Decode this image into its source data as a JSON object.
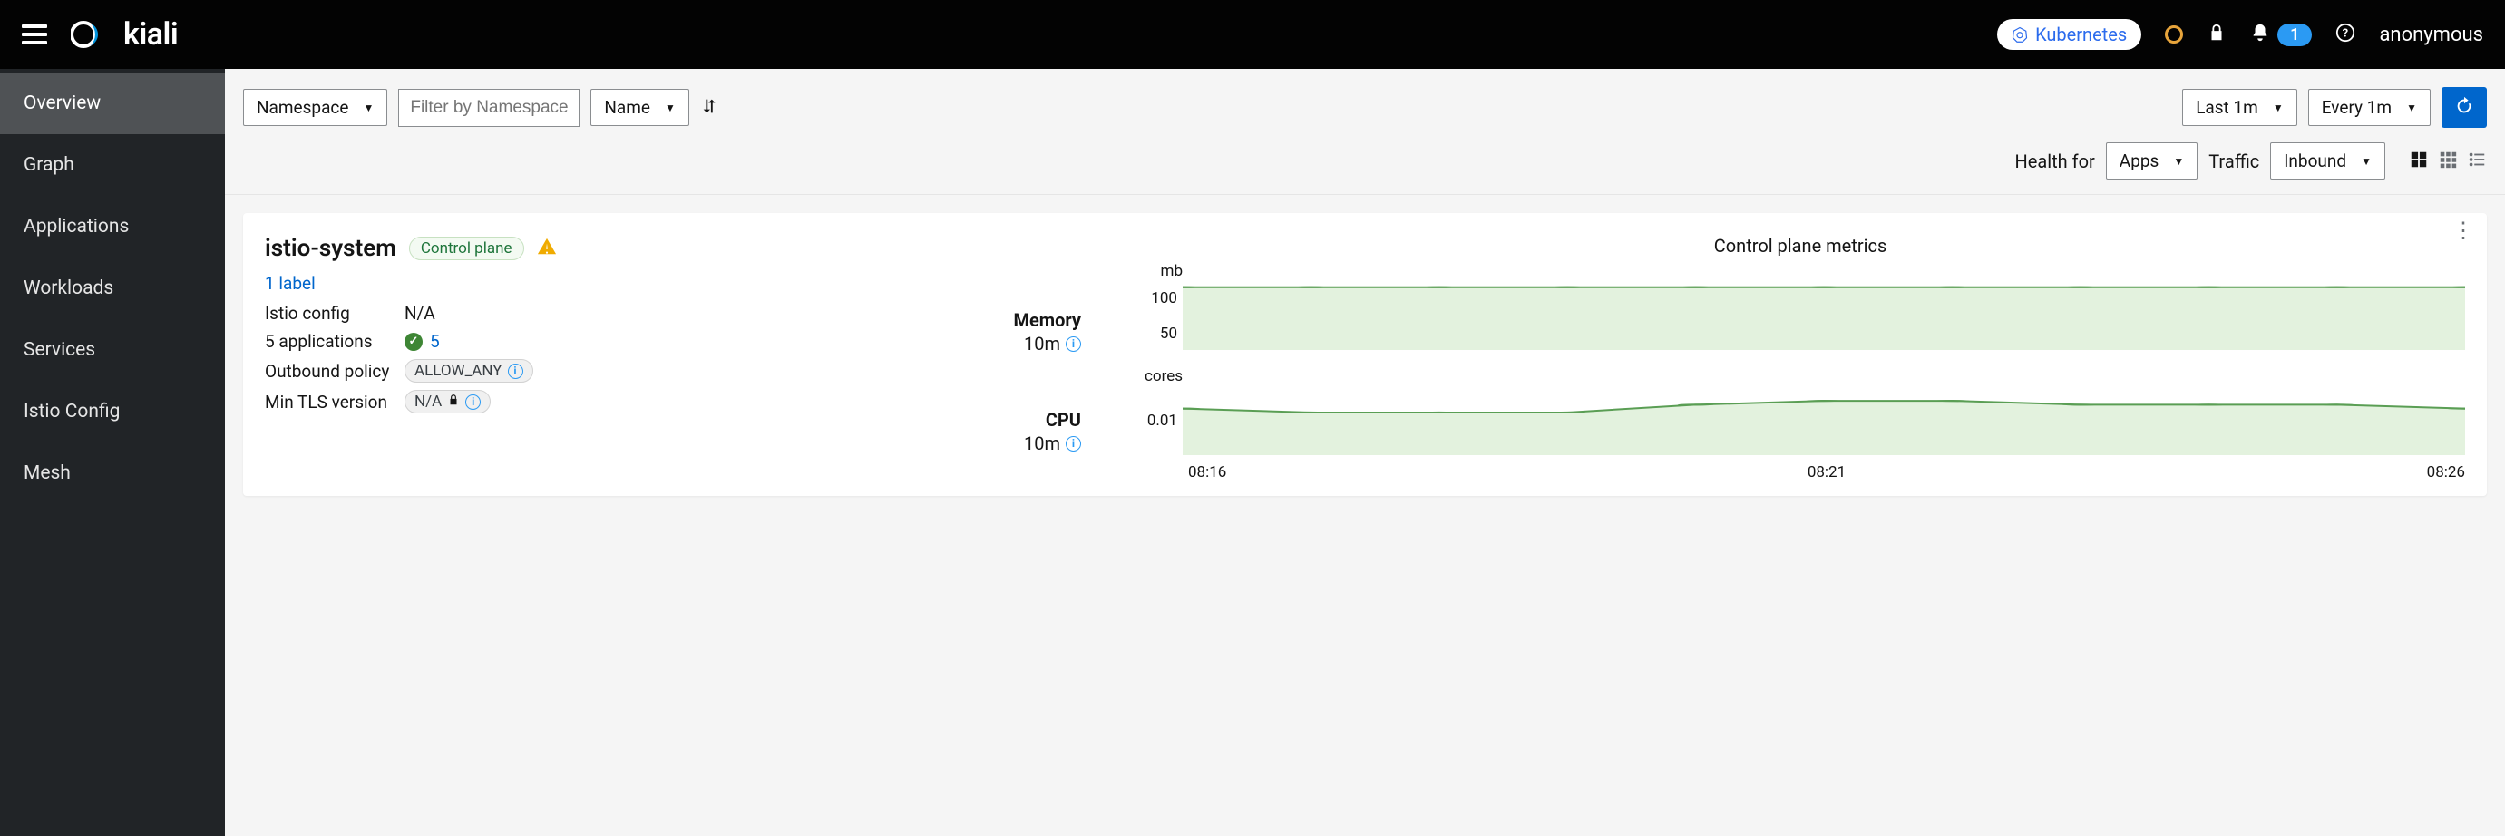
{
  "header": {
    "brand": "kiali",
    "cluster_chip": "Kubernetes",
    "notification_count": "1",
    "username": "anonymous"
  },
  "sidebar": {
    "items": [
      {
        "label": "Overview",
        "active": true
      },
      {
        "label": "Graph"
      },
      {
        "label": "Applications"
      },
      {
        "label": "Workloads"
      },
      {
        "label": "Services"
      },
      {
        "label": "Istio Config"
      },
      {
        "label": "Mesh"
      }
    ]
  },
  "toolbar": {
    "filter_select": "Namespace",
    "filter_placeholder": "Filter by Namespace",
    "sort_by": "Name",
    "duration": "Last 1m",
    "refresh_interval": "Every 1m"
  },
  "subtoolbar": {
    "health_for_label": "Health for",
    "health_for": "Apps",
    "traffic_label": "Traffic",
    "traffic": "Inbound"
  },
  "card": {
    "title": "istio-system",
    "badge": "Control plane",
    "labels_link": "1 label",
    "rows": {
      "istio_config_k": "Istio config",
      "istio_config_v": "N/A",
      "apps_k": "5 applications",
      "apps_v": "5",
      "outbound_k": "Outbound policy",
      "outbound_v": "ALLOW_ANY",
      "tls_k": "Min TLS version",
      "tls_v": "N/A"
    },
    "metrics_title": "Control plane metrics",
    "mem_label": "Memory",
    "mem_age": "10m",
    "cpu_label": "CPU",
    "cpu_age": "10m"
  },
  "chart_data": [
    {
      "type": "area",
      "title": "Memory",
      "ylabel": "mb",
      "ylim": [
        0,
        120
      ],
      "yticks": [
        50,
        100
      ],
      "x": [
        "08:16",
        "08:17",
        "08:18",
        "08:19",
        "08:20",
        "08:21",
        "08:22",
        "08:23",
        "08:24",
        "08:25",
        "08:26"
      ],
      "xticks": [
        "08:16",
        "08:21",
        "08:26"
      ],
      "values": [
        108,
        108,
        108,
        108,
        108,
        108,
        108,
        108,
        108,
        108,
        108
      ]
    },
    {
      "type": "area",
      "title": "CPU",
      "ylabel": "cores",
      "ylim": [
        0,
        0.018
      ],
      "yticks": [
        0.01
      ],
      "x": [
        "08:16",
        "08:17",
        "08:18",
        "08:19",
        "08:20",
        "08:21",
        "08:22",
        "08:23",
        "08:24",
        "08:25",
        "08:26"
      ],
      "xticks": [
        "08:16",
        "08:21",
        "08:26"
      ],
      "values": [
        0.012,
        0.011,
        0.011,
        0.011,
        0.013,
        0.014,
        0.014,
        0.013,
        0.013,
        0.013,
        0.012
      ]
    }
  ]
}
